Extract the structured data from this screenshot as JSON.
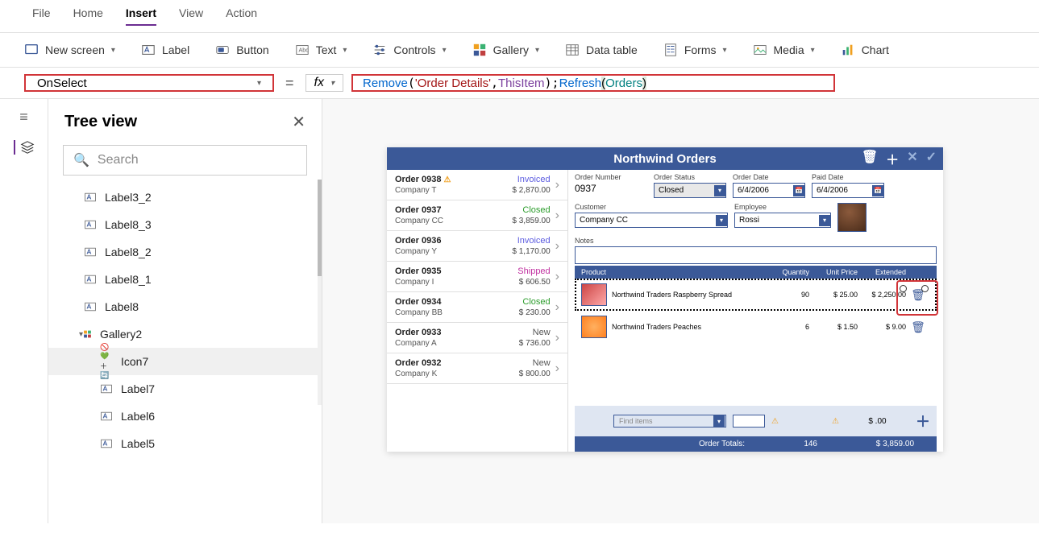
{
  "menu": [
    "File",
    "Home",
    "Insert",
    "View",
    "Action"
  ],
  "menu_active": "Insert",
  "ribbon": {
    "new_screen": "New screen",
    "label": "Label",
    "button": "Button",
    "text": "Text",
    "controls": "Controls",
    "gallery": "Gallery",
    "data_table": "Data table",
    "forms": "Forms",
    "media": "Media",
    "chart": "Chart"
  },
  "formula": {
    "property": "OnSelect",
    "fx": "fx",
    "tokens": {
      "remove": "Remove",
      "str": "'Order Details'",
      "thisitem": "ThisItem",
      "refresh": "Refresh",
      "orders": "Orders"
    }
  },
  "tree": {
    "title": "Tree view",
    "search_placeholder": "Search",
    "items": [
      {
        "name": "Label3_2",
        "type": "label"
      },
      {
        "name": "Label8_3",
        "type": "label"
      },
      {
        "name": "Label8_2",
        "type": "label"
      },
      {
        "name": "Label8_1",
        "type": "label"
      },
      {
        "name": "Label8",
        "type": "label"
      },
      {
        "name": "Gallery2",
        "type": "gallery",
        "expanded": true
      },
      {
        "name": "Icon7",
        "type": "icon",
        "selected": true,
        "child": true
      },
      {
        "name": "Label7",
        "type": "label",
        "child": true
      },
      {
        "name": "Label6",
        "type": "label",
        "child": true
      },
      {
        "name": "Label5",
        "type": "label",
        "child": true
      }
    ]
  },
  "app": {
    "title": "Northwind Orders",
    "orders": [
      {
        "num": "Order 0938",
        "company": "Company T",
        "status": "Invoiced",
        "status_class": "invoiced",
        "amount": "$ 2,870.00",
        "warn": true
      },
      {
        "num": "Order 0937",
        "company": "Company CC",
        "status": "Closed",
        "status_class": "closed",
        "amount": "$ 3,859.00"
      },
      {
        "num": "Order 0936",
        "company": "Company Y",
        "status": "Invoiced",
        "status_class": "invoiced",
        "amount": "$ 1,170.00"
      },
      {
        "num": "Order 0935",
        "company": "Company I",
        "status": "Shipped",
        "status_class": "shipped",
        "amount": "$ 606.50"
      },
      {
        "num": "Order 0934",
        "company": "Company BB",
        "status": "Closed",
        "status_class": "closed",
        "amount": "$ 230.00"
      },
      {
        "num": "Order 0933",
        "company": "Company A",
        "status": "New",
        "status_class": "new",
        "amount": "$ 736.00"
      },
      {
        "num": "Order 0932",
        "company": "Company K",
        "status": "New",
        "status_class": "new",
        "amount": "$ 800.00"
      }
    ],
    "detail": {
      "labels": {
        "order_number": "Order Number",
        "order_status": "Order Status",
        "order_date": "Order Date",
        "paid_date": "Paid Date",
        "customer": "Customer",
        "employee": "Employee",
        "notes": "Notes"
      },
      "order_number": "0937",
      "order_status": "Closed",
      "order_date": "6/4/2006",
      "paid_date": "6/4/2006",
      "customer": "Company CC",
      "employee": "Rossi",
      "columns": {
        "product": "Product",
        "quantity": "Quantity",
        "unit_price": "Unit Price",
        "extended": "Extended"
      },
      "lines": [
        {
          "name": "Northwind Traders Raspberry Spread",
          "qty": "90",
          "price": "$ 25.00",
          "ext": "$ 2,250.00",
          "img": "raspberry",
          "selected": true
        },
        {
          "name": "Northwind Traders Peaches",
          "qty": "6",
          "price": "$ 1.50",
          "ext": "$ 9.00",
          "img": "peach"
        }
      ],
      "find_placeholder": "Find items",
      "add_ext": "$ .00",
      "totals": {
        "label": "Order Totals:",
        "qty": "146",
        "amount": "$ 3,859.00"
      }
    }
  }
}
